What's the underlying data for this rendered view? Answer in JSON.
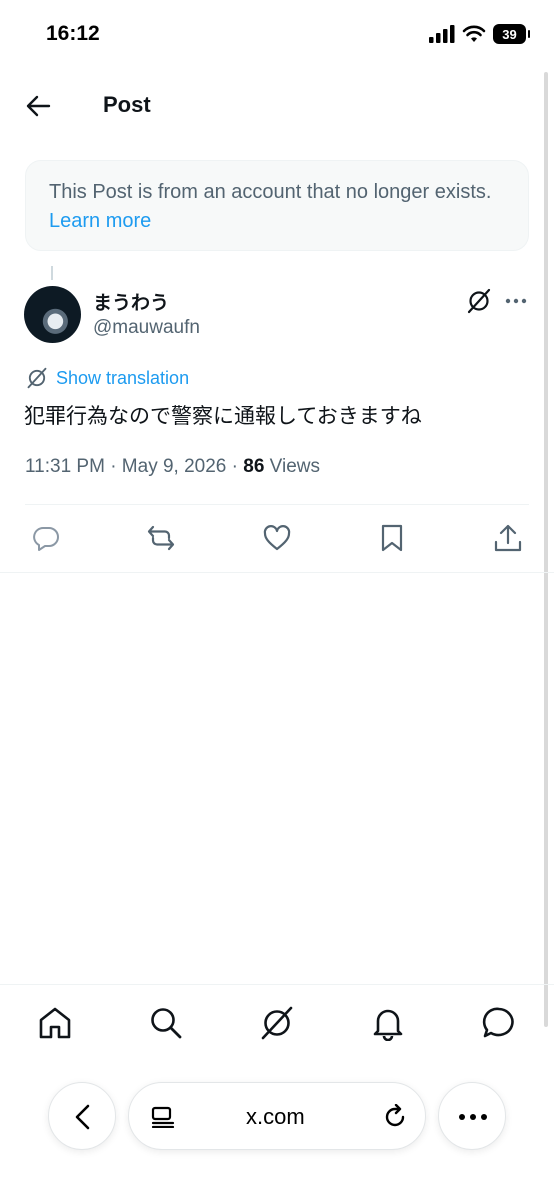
{
  "status_bar": {
    "time": "16:12",
    "battery": "39"
  },
  "header": {
    "title": "Post"
  },
  "notice": {
    "text": "This Post is from an account that no longer exists.",
    "link": "Learn more"
  },
  "post": {
    "display_name": "まうわう",
    "handle": "@mauwaufn",
    "show_translation": "Show translation",
    "text": "犯罪行為なので警察に通報しておきますね",
    "time": "11:31 PM · May 9, 2026 · ",
    "views_count": "86",
    "views_label": " Views"
  },
  "browser": {
    "url": "x.com"
  },
  "colors": {
    "accent": "#1d9bf0",
    "secondary_text": "#536471",
    "primary_text": "#0f1419"
  }
}
